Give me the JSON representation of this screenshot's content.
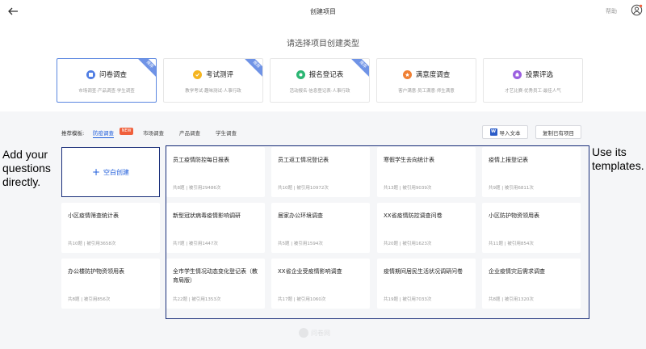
{
  "header": {
    "title": "创建项目",
    "help": "帮助"
  },
  "subtitle": "请选择项目创建类型",
  "project_types": [
    {
      "title": "问卷调查",
      "sub": "市场调查·产品调查·学生调查",
      "badge": "推荐",
      "color": "#4f7de3"
    },
    {
      "title": "考试测评",
      "sub": "教学考试·趣味测试·人事行政",
      "badge": "推荐",
      "color": "#f5b520"
    },
    {
      "title": "报名登记表",
      "sub": "活动报名·信息登记表·人事行政",
      "badge": "推荐",
      "color": "#2bb673"
    },
    {
      "title": "满意度调查",
      "sub": "客户满意·员工满意·师生满意",
      "color": "#f08034"
    },
    {
      "title": "投票评选",
      "sub": "才艺比赛·优秀员工·最佳人气",
      "color": "#9b5fe0"
    }
  ],
  "templates_label": "推荐模板:",
  "filter_tabs": [
    "防疫调查",
    "市场调查",
    "产品调查",
    "学生调查"
  ],
  "new_badge": "NEW",
  "toolbar": {
    "import_text": "导入文本",
    "copy_project": "复制已有项目",
    "word_icon": "W"
  },
  "blank_create": "空白创建",
  "templates": [
    {
      "title": "员工疫情防控每日报表",
      "stat": "共8题 | 被引用29486次"
    },
    {
      "title": "员工返工情况登记表",
      "stat": "共10题 | 被引用10972次"
    },
    {
      "title": "寒假学生去向统计表",
      "stat": "共13题 | 被引用9039次"
    },
    {
      "title": "疫情上报登记表",
      "stat": "共9题 | 被引用6811次"
    },
    {
      "title": "小区疫情筛查统计表",
      "stat": "共10题 | 被引用3658次"
    },
    {
      "title": "新型冠状病毒疫情影响调研",
      "stat": "共7题 | 被引用1447次"
    },
    {
      "title": "居家办公环境调查",
      "stat": "共5题 | 被引用1594次"
    },
    {
      "title": "XX省疫情防控调查问卷",
      "stat": "共20题 | 被引用1623次"
    },
    {
      "title": "小区防护物资领用表",
      "stat": "共11题 | 被引用854次"
    },
    {
      "title": "办公楼防护物资领用表",
      "stat": "共8题 | 被引用856次"
    },
    {
      "title": "全市学生情况动态变化登记表（教育局版）",
      "stat": "共22题 | 被引用1353次"
    },
    {
      "title": "XX省企业受疫情影响调查",
      "stat": "共17题 | 被引用1060次"
    },
    {
      "title": "疫情期间居民生活状况调研问卷",
      "stat": "共19题 | 被引用7033次"
    },
    {
      "title": "企业疫情灾后需求调查",
      "stat": "共8题 | 被引用1320次"
    }
  ],
  "annotations": {
    "left": [
      "Add your",
      "questions",
      "directly."
    ],
    "right": [
      "Use its",
      "templates."
    ]
  },
  "watermark": "问卷网"
}
